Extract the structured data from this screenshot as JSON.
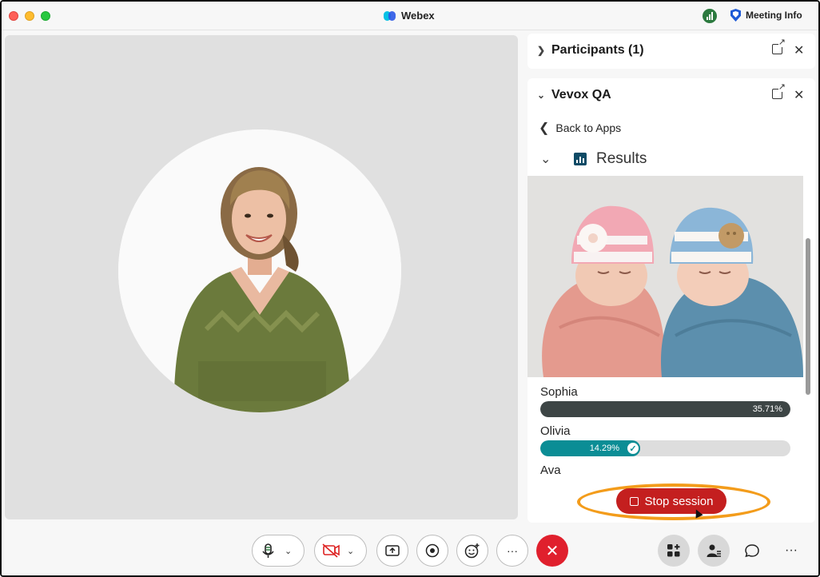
{
  "window": {
    "title": "Webex",
    "meeting_info": "Meeting Info"
  },
  "sidebar": {
    "participants_title": "Participants (1)",
    "app_title": "Vevox QA",
    "back_label": "Back to Apps",
    "results_label": "Results",
    "options": [
      {
        "name": "Sophia",
        "percent_label": "35.71%",
        "fraction": 0.3571,
        "color": "#3d4545",
        "correct": false
      },
      {
        "name": "Olivia",
        "percent_label": "14.29%",
        "fraction": 0.1429,
        "color": "#0b8d95",
        "correct": true
      },
      {
        "name": "Ava",
        "percent_label": "",
        "fraction": null,
        "color": "",
        "correct": false
      }
    ],
    "stop_label": "Stop session"
  },
  "toolbar": {
    "more_label": "···",
    "overflow_label": "···"
  },
  "colors": {
    "accent_orange": "#f39c1b",
    "stop_red": "#c41f1f",
    "end_call_red": "#e0202d",
    "teal": "#0b8d95"
  },
  "icons": [
    "webex-logo-icon",
    "signal-icon",
    "shield-icon",
    "popout-icon",
    "close-icon",
    "chevron-right-icon",
    "chevron-down-icon",
    "chevron-left-icon",
    "results-chart-icon",
    "check-icon",
    "microphone-icon",
    "video-off-icon",
    "share-icon",
    "record-icon",
    "reactions-icon",
    "more-icon",
    "end-call-icon",
    "apps-icon",
    "participants-icon",
    "chat-icon",
    "overflow-icon"
  ]
}
